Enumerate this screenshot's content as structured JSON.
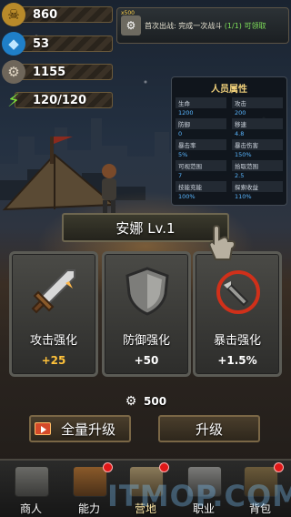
{
  "resources": [
    {
      "icon": "skull-gold-icon",
      "value": "860"
    },
    {
      "icon": "blue-gem-icon",
      "value": "53"
    },
    {
      "icon": "scrap-metal-icon",
      "value": "1155"
    },
    {
      "icon": "energy-bolt-icon",
      "value": "120/120"
    }
  ],
  "quest": {
    "tag": "x500",
    "prefix": "首次出战: 完成一次战斗",
    "progress": "(1/1)",
    "action": "可领取"
  },
  "attributes": {
    "title": "人员属性",
    "items": [
      {
        "name": "生命",
        "value": "1200"
      },
      {
        "name": "攻击",
        "value": "200"
      },
      {
        "name": "防御",
        "value": "0"
      },
      {
        "name": "移速",
        "value": "4.8"
      },
      {
        "name": "暴击率",
        "value": "5%"
      },
      {
        "name": "暴击伤害",
        "value": "150%"
      },
      {
        "name": "可视范围",
        "value": "7"
      },
      {
        "name": "拾取范围",
        "value": "2.5"
      },
      {
        "name": "技能充能",
        "value": "100%"
      },
      {
        "name": "探索收益",
        "value": "110%"
      }
    ]
  },
  "character": {
    "name": "安娜 Lv.1"
  },
  "upgrades": [
    {
      "label": "攻击强化",
      "bonus": "+25",
      "icon": "sword-icon"
    },
    {
      "label": "防御强化",
      "bonus": "+50",
      "icon": "shield-icon"
    },
    {
      "label": "暴击强化",
      "bonus": "+1.5%",
      "icon": "bullet-target-icon"
    }
  ],
  "cost": {
    "icon": "scrap-metal-icon",
    "value": "500"
  },
  "buttons": {
    "upgrade_all": "全量升级",
    "upgrade_one": "升级"
  },
  "nav": [
    {
      "label": "商人",
      "icon": "merchant-stall-icon",
      "badge": false
    },
    {
      "label": "能力",
      "icon": "gear-crate-icon",
      "badge": true
    },
    {
      "label": "营地",
      "icon": "tent-icon",
      "badge": true
    },
    {
      "label": "职业",
      "icon": "armor-vest-icon",
      "badge": false
    },
    {
      "label": "背包",
      "icon": "backpack-icon",
      "badge": true
    }
  ],
  "watermark": "ITMOP.COM",
  "colors": {
    "attr_value": "#59b6ff",
    "quest_highlight": "#7fe05a",
    "bonus_gold": "#ffc23a",
    "badge": "#e01818"
  }
}
